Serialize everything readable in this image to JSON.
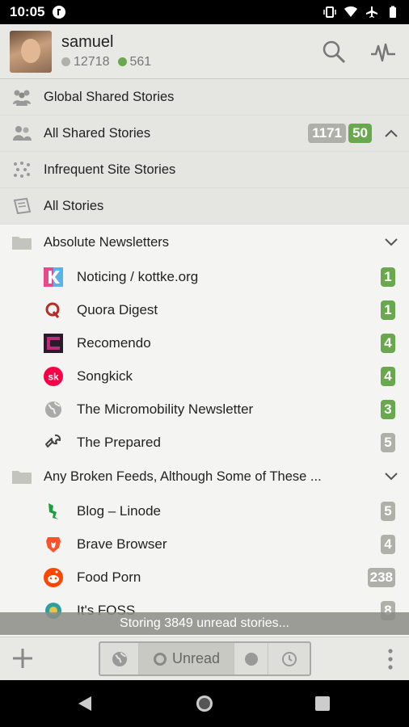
{
  "status": {
    "time": "10:05"
  },
  "user": {
    "name": "samuel",
    "neutral_count": "12718",
    "positive_count": "561"
  },
  "header_icons": [
    "search-icon",
    "activity-icon"
  ],
  "top_rows": [
    {
      "name": "global-shared-stories",
      "label": "Global Shared Stories"
    },
    {
      "name": "all-shared-stories",
      "label": "All Shared Stories",
      "badge_gray": "1171",
      "badge_green": "50"
    },
    {
      "name": "infrequent-site-stories",
      "label": "Infrequent Site Stories"
    },
    {
      "name": "all-stories",
      "label": "All Stories"
    }
  ],
  "folders": [
    {
      "label": "Absolute Newsletters",
      "feeds": [
        {
          "label": "Noticing / kottke.org",
          "count": "1",
          "color": "green",
          "icon": "kottke-icon"
        },
        {
          "label": "Quora Digest",
          "count": "1",
          "color": "green",
          "icon": "quora-icon"
        },
        {
          "label": "Recomendo",
          "count": "4",
          "color": "green",
          "icon": "recomendo-icon"
        },
        {
          "label": "Songkick",
          "count": "4",
          "color": "green",
          "icon": "songkick-icon"
        },
        {
          "label": "The Micromobility Newsletter",
          "count": "3",
          "color": "green",
          "icon": "globe-icon"
        },
        {
          "label": "The Prepared",
          "count": "5",
          "color": "gray",
          "icon": "wrench-icon"
        }
      ]
    },
    {
      "label": "Any Broken Feeds, Although Some of These ...",
      "feeds": [
        {
          "label": "Blog – Linode",
          "count": "5",
          "color": "gray",
          "icon": "linode-icon"
        },
        {
          "label": "Brave Browser",
          "count": "4",
          "color": "gray",
          "icon": "brave-icon"
        },
        {
          "label": "Food Porn",
          "count": "238",
          "color": "gray",
          "icon": "reddit-icon"
        },
        {
          "label": "It's FOSS",
          "count": "8",
          "color": "gray",
          "icon": "itsfoss-icon"
        }
      ]
    }
  ],
  "storing_text": "Storing 3849 unread stories...",
  "toolbar": {
    "unread_label": "Unread"
  },
  "colors": {
    "green": "#6aa84f",
    "gray": "#b0b0aa",
    "neutral_dot": "#b0b0aa",
    "positive_dot": "#6aa84f"
  }
}
